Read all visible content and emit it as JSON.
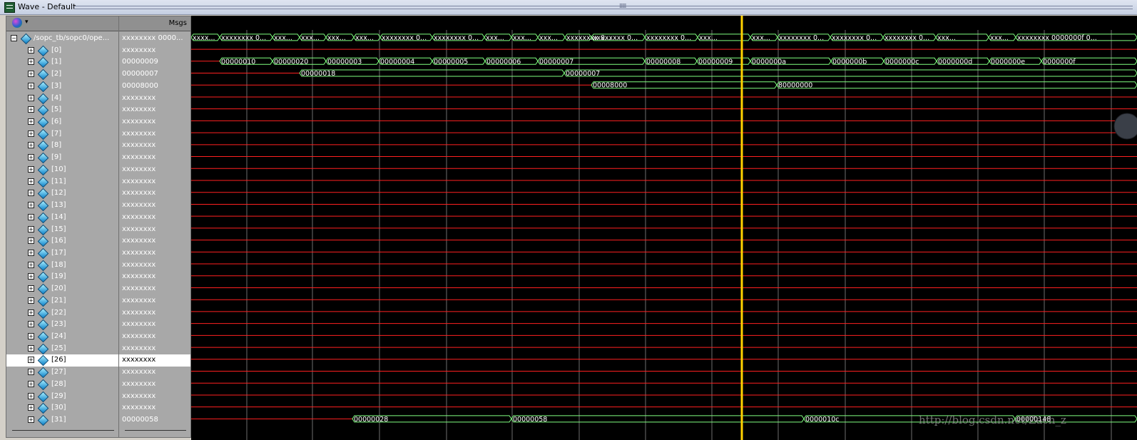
{
  "window": {
    "title": "Wave - Default"
  },
  "colors": {
    "background": "#000000",
    "signal_x": "#ff2020",
    "bus": "#80ff80",
    "grid": "#6e6e6e",
    "cursor": "#ffd200",
    "label_text": "#ffffff"
  },
  "header": {
    "msgs_label": "Msgs"
  },
  "signals": [
    {
      "name": "/sopc_tb/sopc0/ope...",
      "value": "xxxxxxxx 0000...",
      "expand": "−"
    },
    {
      "name": "[0]",
      "value": "xxxxxxxx",
      "expand": "+"
    },
    {
      "name": "[1]",
      "value": "00000009",
      "expand": "+"
    },
    {
      "name": "[2]",
      "value": "00000007",
      "expand": "+"
    },
    {
      "name": "[3]",
      "value": "00008000",
      "expand": "+"
    },
    {
      "name": "[4]",
      "value": "xxxxxxxx",
      "expand": "+"
    },
    {
      "name": "[5]",
      "value": "xxxxxxxx",
      "expand": "+"
    },
    {
      "name": "[6]",
      "value": "xxxxxxxx",
      "expand": "+"
    },
    {
      "name": "[7]",
      "value": "xxxxxxxx",
      "expand": "+"
    },
    {
      "name": "[8]",
      "value": "xxxxxxxx",
      "expand": "+"
    },
    {
      "name": "[9]",
      "value": "xxxxxxxx",
      "expand": "+"
    },
    {
      "name": "[10]",
      "value": "xxxxxxxx",
      "expand": "+"
    },
    {
      "name": "[11]",
      "value": "xxxxxxxx",
      "expand": "+"
    },
    {
      "name": "[12]",
      "value": "xxxxxxxx",
      "expand": "+"
    },
    {
      "name": "[13]",
      "value": "xxxxxxxx",
      "expand": "+"
    },
    {
      "name": "[14]",
      "value": "xxxxxxxx",
      "expand": "+"
    },
    {
      "name": "[15]",
      "value": "xxxxxxxx",
      "expand": "+"
    },
    {
      "name": "[16]",
      "value": "xxxxxxxx",
      "expand": "+"
    },
    {
      "name": "[17]",
      "value": "xxxxxxxx",
      "expand": "+"
    },
    {
      "name": "[18]",
      "value": "xxxxxxxx",
      "expand": "+"
    },
    {
      "name": "[19]",
      "value": "xxxxxxxx",
      "expand": "+"
    },
    {
      "name": "[20]",
      "value": "xxxxxxxx",
      "expand": "+"
    },
    {
      "name": "[21]",
      "value": "xxxxxxxx",
      "expand": "+"
    },
    {
      "name": "[22]",
      "value": "xxxxxxxx",
      "expand": "+"
    },
    {
      "name": "[23]",
      "value": "xxxxxxxx",
      "expand": "+"
    },
    {
      "name": "[24]",
      "value": "xxxxxxxx",
      "expand": "+"
    },
    {
      "name": "[25]",
      "value": "xxxxxxxx",
      "expand": "+"
    },
    {
      "name": "[26]",
      "value": "xxxxxxxx",
      "expand": "+",
      "selected": true
    },
    {
      "name": "[27]",
      "value": "xxxxxxxx",
      "expand": "+"
    },
    {
      "name": "[28]",
      "value": "xxxxxxxx",
      "expand": "+"
    },
    {
      "name": "[29]",
      "value": "xxxxxxxx",
      "expand": "+"
    },
    {
      "name": "[30]",
      "value": "xxxxxxxx",
      "expand": "+"
    },
    {
      "name": "[31]",
      "value": "00000058",
      "expand": "+"
    }
  ],
  "waves": {
    "top_bus": [
      "xxxx...",
      "xxxxxxxx 0...",
      "xxx...",
      "xxx...",
      "xxx...",
      "xxx...",
      "xxxxxxxx 0...",
      "xxxxxxxx 0...",
      "xxx...",
      "xxx...",
      "xxx...",
      "xxxxxxxx 0...",
      "xxxxxxxx 0...",
      "xxxxxxxx 0...",
      "xxx...",
      "xxx...",
      "xxxxxxxx 0...",
      "xxxxxxxx 0...",
      "xxxxxxxx 0...",
      "xxx...",
      "xxx...",
      "xxxxxxxx 0000000f 0..."
    ],
    "reg1": [
      "00000010",
      "00000020",
      "00000003",
      "00000004",
      "00000005",
      "00000006",
      "00000007",
      "00000008",
      "00000009",
      "0000000a",
      "0000000b",
      "0000000c",
      "0000000d",
      "0000000e",
      "0000000f"
    ],
    "reg2": [
      "00000018",
      "00000007"
    ],
    "reg3": [
      "00008000",
      "80000000"
    ],
    "reg31": [
      "00000028",
      "00000058",
      "0000010c",
      "00000148"
    ]
  },
  "watermark": "http://blog.csdn.net/Zach_z"
}
